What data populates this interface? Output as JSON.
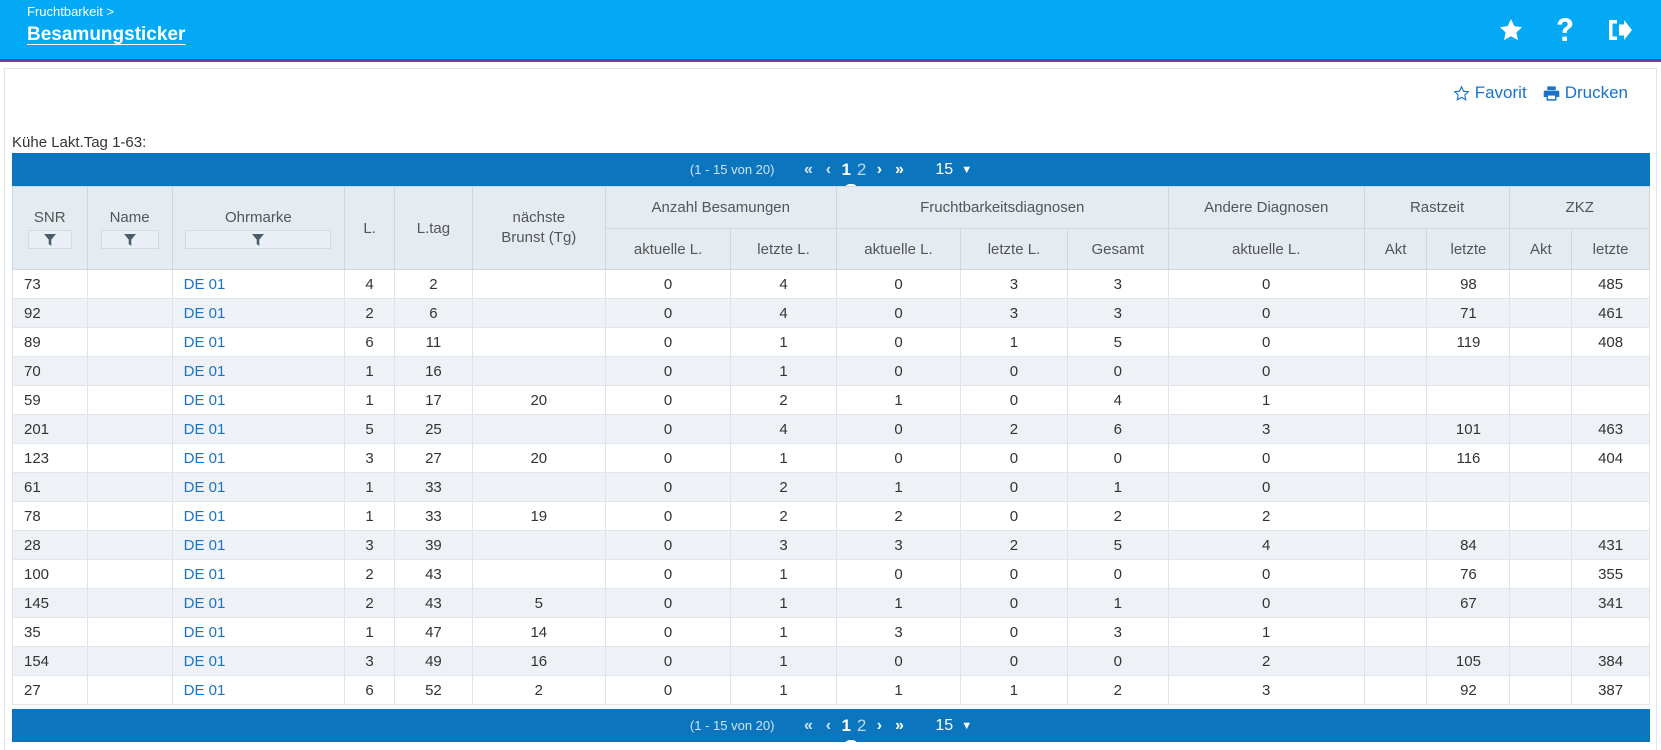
{
  "header": {
    "breadcrumb": "Fruchtbarkeit >",
    "title": "Besamungsticker",
    "icons": [
      "star-icon",
      "help-icon",
      "logout-icon"
    ]
  },
  "actions": {
    "favorite_label": "Favorit",
    "print_label": "Drucken"
  },
  "section_label": "Kühe Lakt.Tag 1-63:",
  "pager": {
    "range": "(1 - 15 von 20)",
    "pages": [
      "1",
      "2"
    ],
    "active_page": "1",
    "page_size": "15"
  },
  "columns": {
    "snr": "SNR",
    "name": "Name",
    "ohrmarke": "Ohrmarke",
    "l": "L.",
    "ltag": "L.tag",
    "brunst": "nächste Brunst (Tg)",
    "anzahl": "Anzahl Besamungen",
    "frucht": "Fruchtbarkeitsdiagnosen",
    "andere": "Andere Diagnosen",
    "rastzeit": "Rastzeit",
    "zkz": "ZKZ",
    "aktuelle": "aktuelle L.",
    "letzte_l": "letzte L.",
    "gesamt": "Gesamt",
    "akt": "Akt",
    "letzte": "letzte"
  },
  "rows": [
    {
      "snr": "73",
      "name": "",
      "ohr": "DE 01",
      "l": "4",
      "ltag": "2",
      "brunst": "",
      "ab_akt": "0",
      "ab_letzte": "4",
      "fd_akt": "0",
      "fd_letzte": "3",
      "fd_gesamt": "3",
      "ad_akt": "0",
      "rz_akt": "",
      "rz_letzte": "98",
      "zkz_akt": "",
      "zkz_letzte": "485"
    },
    {
      "snr": "92",
      "name": "",
      "ohr": "DE 01",
      "l": "2",
      "ltag": "6",
      "brunst": "",
      "ab_akt": "0",
      "ab_letzte": "4",
      "fd_akt": "0",
      "fd_letzte": "3",
      "fd_gesamt": "3",
      "ad_akt": "0",
      "rz_akt": "",
      "rz_letzte": "71",
      "zkz_akt": "",
      "zkz_letzte": "461"
    },
    {
      "snr": "89",
      "name": "",
      "ohr": "DE 01",
      "l": "6",
      "ltag": "11",
      "brunst": "",
      "ab_akt": "0",
      "ab_letzte": "1",
      "fd_akt": "0",
      "fd_letzte": "1",
      "fd_gesamt": "5",
      "ad_akt": "0",
      "rz_akt": "",
      "rz_letzte": "119",
      "zkz_akt": "",
      "zkz_letzte": "408"
    },
    {
      "snr": "70",
      "name": "",
      "ohr": "DE 01",
      "l": "1",
      "ltag": "16",
      "brunst": "",
      "ab_akt": "0",
      "ab_letzte": "1",
      "fd_akt": "0",
      "fd_letzte": "0",
      "fd_gesamt": "0",
      "ad_akt": "0",
      "rz_akt": "",
      "rz_letzte": "",
      "zkz_akt": "",
      "zkz_letzte": ""
    },
    {
      "snr": "59",
      "name": "",
      "ohr": "DE 01",
      "l": "1",
      "ltag": "17",
      "brunst": "20",
      "ab_akt": "0",
      "ab_letzte": "2",
      "fd_akt": "1",
      "fd_letzte": "0",
      "fd_gesamt": "4",
      "ad_akt": "1",
      "rz_akt": "",
      "rz_letzte": "",
      "zkz_akt": "",
      "zkz_letzte": ""
    },
    {
      "snr": "201",
      "name": "",
      "ohr": "DE 01",
      "l": "5",
      "ltag": "25",
      "brunst": "",
      "ab_akt": "0",
      "ab_letzte": "4",
      "fd_akt": "0",
      "fd_letzte": "2",
      "fd_gesamt": "6",
      "ad_akt": "3",
      "rz_akt": "",
      "rz_letzte": "101",
      "zkz_akt": "",
      "zkz_letzte": "463"
    },
    {
      "snr": "123",
      "name": "",
      "ohr": "DE 01",
      "l": "3",
      "ltag": "27",
      "brunst": "20",
      "ab_akt": "0",
      "ab_letzte": "1",
      "fd_akt": "0",
      "fd_letzte": "0",
      "fd_gesamt": "0",
      "ad_akt": "0",
      "rz_akt": "",
      "rz_letzte": "116",
      "zkz_akt": "",
      "zkz_letzte": "404"
    },
    {
      "snr": "61",
      "name": "",
      "ohr": "DE 01",
      "l": "1",
      "ltag": "33",
      "brunst": "",
      "ab_akt": "0",
      "ab_letzte": "2",
      "fd_akt": "1",
      "fd_letzte": "0",
      "fd_gesamt": "1",
      "ad_akt": "0",
      "rz_akt": "",
      "rz_letzte": "",
      "zkz_akt": "",
      "zkz_letzte": ""
    },
    {
      "snr": "78",
      "name": "",
      "ohr": "DE 01",
      "l": "1",
      "ltag": "33",
      "brunst": "19",
      "ab_akt": "0",
      "ab_letzte": "2",
      "fd_akt": "2",
      "fd_letzte": "0",
      "fd_gesamt": "2",
      "ad_akt": "2",
      "rz_akt": "",
      "rz_letzte": "",
      "zkz_akt": "",
      "zkz_letzte": ""
    },
    {
      "snr": "28",
      "name": "",
      "ohr": "DE 01",
      "l": "3",
      "ltag": "39",
      "brunst": "",
      "ab_akt": "0",
      "ab_letzte": "3",
      "fd_akt": "3",
      "fd_letzte": "2",
      "fd_gesamt": "5",
      "ad_akt": "4",
      "rz_akt": "",
      "rz_letzte": "84",
      "zkz_akt": "",
      "zkz_letzte": "431"
    },
    {
      "snr": "100",
      "name": "",
      "ohr": "DE 01",
      "l": "2",
      "ltag": "43",
      "brunst": "",
      "ab_akt": "0",
      "ab_letzte": "1",
      "fd_akt": "0",
      "fd_letzte": "0",
      "fd_gesamt": "0",
      "ad_akt": "0",
      "rz_akt": "",
      "rz_letzte": "76",
      "zkz_akt": "",
      "zkz_letzte": "355"
    },
    {
      "snr": "145",
      "name": "",
      "ohr": "DE 01",
      "l": "2",
      "ltag": "43",
      "brunst": "5",
      "ab_akt": "0",
      "ab_letzte": "1",
      "fd_akt": "1",
      "fd_letzte": "0",
      "fd_gesamt": "1",
      "ad_akt": "0",
      "rz_akt": "",
      "rz_letzte": "67",
      "zkz_akt": "",
      "zkz_letzte": "341"
    },
    {
      "snr": "35",
      "name": "",
      "ohr": "DE 01",
      "l": "1",
      "ltag": "47",
      "brunst": "14",
      "ab_akt": "0",
      "ab_letzte": "1",
      "fd_akt": "3",
      "fd_letzte": "0",
      "fd_gesamt": "3",
      "ad_akt": "1",
      "rz_akt": "",
      "rz_letzte": "",
      "zkz_akt": "",
      "zkz_letzte": ""
    },
    {
      "snr": "154",
      "name": "",
      "ohr": "DE 01",
      "l": "3",
      "ltag": "49",
      "brunst": "16",
      "ab_akt": "0",
      "ab_letzte": "1",
      "fd_akt": "0",
      "fd_letzte": "0",
      "fd_gesamt": "0",
      "ad_akt": "2",
      "rz_akt": "",
      "rz_letzte": "105",
      "zkz_akt": "",
      "zkz_letzte": "384"
    },
    {
      "snr": "27",
      "name": "",
      "ohr": "DE 01",
      "l": "6",
      "ltag": "52",
      "brunst": "2",
      "ab_akt": "0",
      "ab_letzte": "1",
      "fd_akt": "1",
      "fd_letzte": "1",
      "fd_gesamt": "2",
      "ad_akt": "3",
      "rz_akt": "",
      "rz_letzte": "92",
      "zkz_akt": "",
      "zkz_letzte": "387"
    }
  ]
}
